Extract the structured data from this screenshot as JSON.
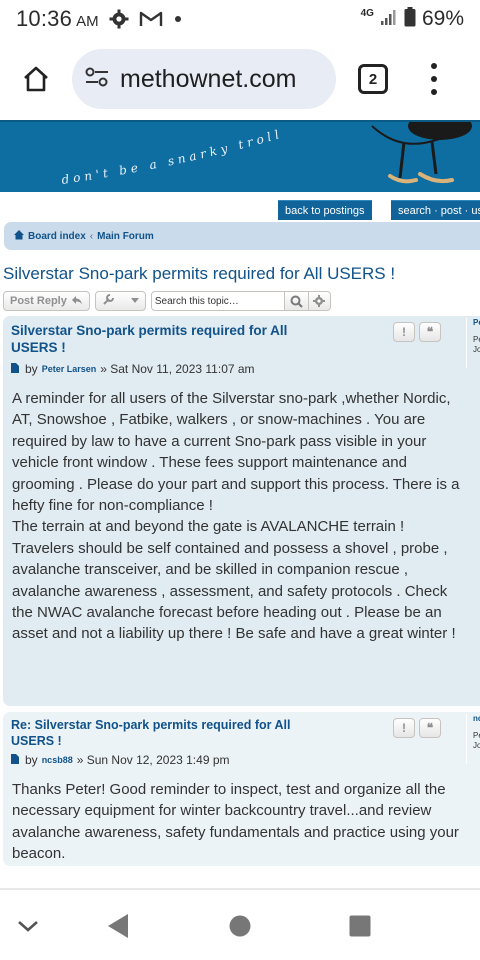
{
  "status_bar": {
    "time": "10:36",
    "ampm": "AM",
    "network": "4G",
    "battery": "69%",
    "icons": [
      "gear-icon",
      "gmail-icon",
      "notification-dot-icon",
      "signal-icon",
      "battery-icon"
    ]
  },
  "browser": {
    "url": "methownet.com",
    "tab_count": "2",
    "icons": [
      "home-icon",
      "site-settings-icon",
      "tabs-icon",
      "overflow-menu-icon"
    ]
  },
  "header": {
    "slogan": "don't be a snarky troll",
    "nav_buttons": [
      "back to postings",
      "search · post · us"
    ]
  },
  "breadcrumbs": {
    "board_index": "Board index",
    "main_forum": "Main Forum"
  },
  "topic": {
    "title": "Silverstar Sno-park permits required for All USERS !",
    "post_reply": "Post Reply",
    "search_placeholder": "Search this topic…"
  },
  "posts": [
    {
      "subject": "Silverstar Sno-park permits required for All USERS !",
      "by": "by",
      "author": "Peter Larsen",
      "date": "» Sat Nov 11, 2023 11:07 am",
      "body": [
        "A reminder for all users of the Silverstar sno-park ,whether Nordic, AT, Snowshoe , Fatbike, walkers , or snow-machines . You are required by law to have a current Sno-park pass visible in your vehicle front window . These fees support maintenance and grooming . Please do your part and support this process. There is a hefty fine for non-compliance !",
        "The terrain at and beyond the gate is AVALANCHE terrain ! Travelers should be self contained and possess a shovel , probe , avalanche transceiver, and be skilled in companion rescue , avalanche awareness , assessment, and safety protocols . Check the NWAC avalanche forecast before heading out . Please be an asset and not a liability up there ! Be safe and have a great winter !"
      ],
      "profile_name": "Pe",
      "profile_meta": [
        "Pe",
        "Jo"
      ]
    },
    {
      "subject": "Re: Silverstar Sno-park permits required for All USERS !",
      "by": "by",
      "author": "ncsb88",
      "date": "» Sun Nov 12, 2023 1:49 pm",
      "body": [
        "Thanks Peter! Good reminder to inspect, test and organize all the necessary equipment for winter backcountry travel...and review avalanche awareness, safety fundamentals and practice using your beacon."
      ],
      "profile_name": "nc",
      "profile_meta": [
        "Pe",
        "Jo"
      ]
    }
  ],
  "post_tool_icons": [
    "report-icon",
    "quote-icon"
  ],
  "nav_bar": [
    "collapse-chevron-icon",
    "back-triangle-icon",
    "home-circle-icon",
    "recents-square-icon"
  ]
}
